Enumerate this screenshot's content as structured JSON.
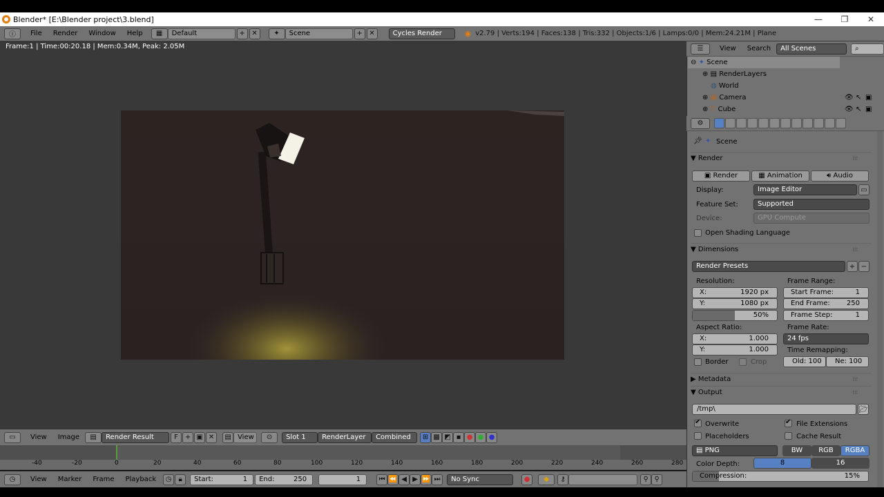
{
  "window": {
    "title": "Blender* [E:\\Blender project\\3.blend]"
  },
  "menubar": {
    "items": [
      "File",
      "Render",
      "Window",
      "Help"
    ],
    "screen_layout": "Default",
    "scene": "Scene",
    "engine": "Cycles Render",
    "stats": "v2.79 | Verts:194 | Faces:138 | Tris:332 | Objects:1/6 | Lamps:0/0 | Mem:24.21M | Plane"
  },
  "viewport": {
    "info": "Frame:1 | Time:00:20.18 | Mem:0.34M, Peak: 2.05M"
  },
  "image_editor_header": {
    "view": "View",
    "image": "Image",
    "image_name": "Render Result",
    "fake_user": "F",
    "view2": "View",
    "slot": "Slot 1",
    "layer": "RenderLayer",
    "pass": "Combined"
  },
  "timeline": {
    "ticks": [
      "-40",
      "-20",
      "0",
      "20",
      "40",
      "60",
      "80",
      "100",
      "120",
      "140",
      "160",
      "180",
      "200",
      "220",
      "240",
      "260",
      "280"
    ],
    "view": "View",
    "marker": "Marker",
    "frame": "Frame",
    "playback": "Playback",
    "start_label": "Start:",
    "start": "1",
    "end_label": "End:",
    "end": "250",
    "current": "1",
    "sync": "No Sync"
  },
  "outliner": {
    "view": "View",
    "search": "Search",
    "display_mode": "All Scenes",
    "rows": [
      "Scene",
      "RenderLayers",
      "World",
      "Camera",
      "Cube"
    ]
  },
  "properties": {
    "context": "Scene",
    "render_panel": {
      "title": "Render",
      "render_btn": "Render",
      "animation_btn": "Animation",
      "audio_btn": "Audio",
      "display_label": "Display:",
      "display": "Image Editor",
      "feature_label": "Feature Set:",
      "feature": "Supported",
      "device_label": "Device:",
      "device": "GPU Compute",
      "osl": "Open Shading Language"
    },
    "dimensions": {
      "title": "Dimensions",
      "presets": "Render Presets",
      "resolution_label": "Resolution:",
      "res_x_label": "X:",
      "res_x": "1920 px",
      "res_y_label": "Y:",
      "res_y": "1080 px",
      "res_pct": "50%",
      "res_pct_value": 0.5,
      "frame_range_label": "Frame Range:",
      "start_label": "Start Frame:",
      "start": "1",
      "end_label": "End Frame:",
      "end": "250",
      "step_label": "Frame Step:",
      "step": "1",
      "aspect_label": "Aspect Ratio:",
      "asp_x_label": "X:",
      "asp_x": "1.000",
      "asp_y_label": "Y:",
      "asp_y": "1.000",
      "frame_rate_label": "Frame Rate:",
      "frame_rate": "24 fps",
      "remap_label": "Time Remapping:",
      "old": "Old: 100",
      "new": "Ne: 100",
      "border": "Border",
      "crop": "Crop"
    },
    "metadata": {
      "title": "Metadata"
    },
    "output": {
      "title": "Output",
      "path": "/tmp\\",
      "overwrite": "Overwrite",
      "file_ext": "File Extensions",
      "placeholders": "Placeholders",
      "cache": "Cache Result",
      "format": "PNG",
      "bw": "BW",
      "rgb": "RGB",
      "rgba": "RGBA",
      "color_depth_label": "Color Depth:",
      "depth8": "8",
      "depth16": "16",
      "compression_label": "Compression:",
      "compression": "15%",
      "compression_value": 0.15
    }
  }
}
